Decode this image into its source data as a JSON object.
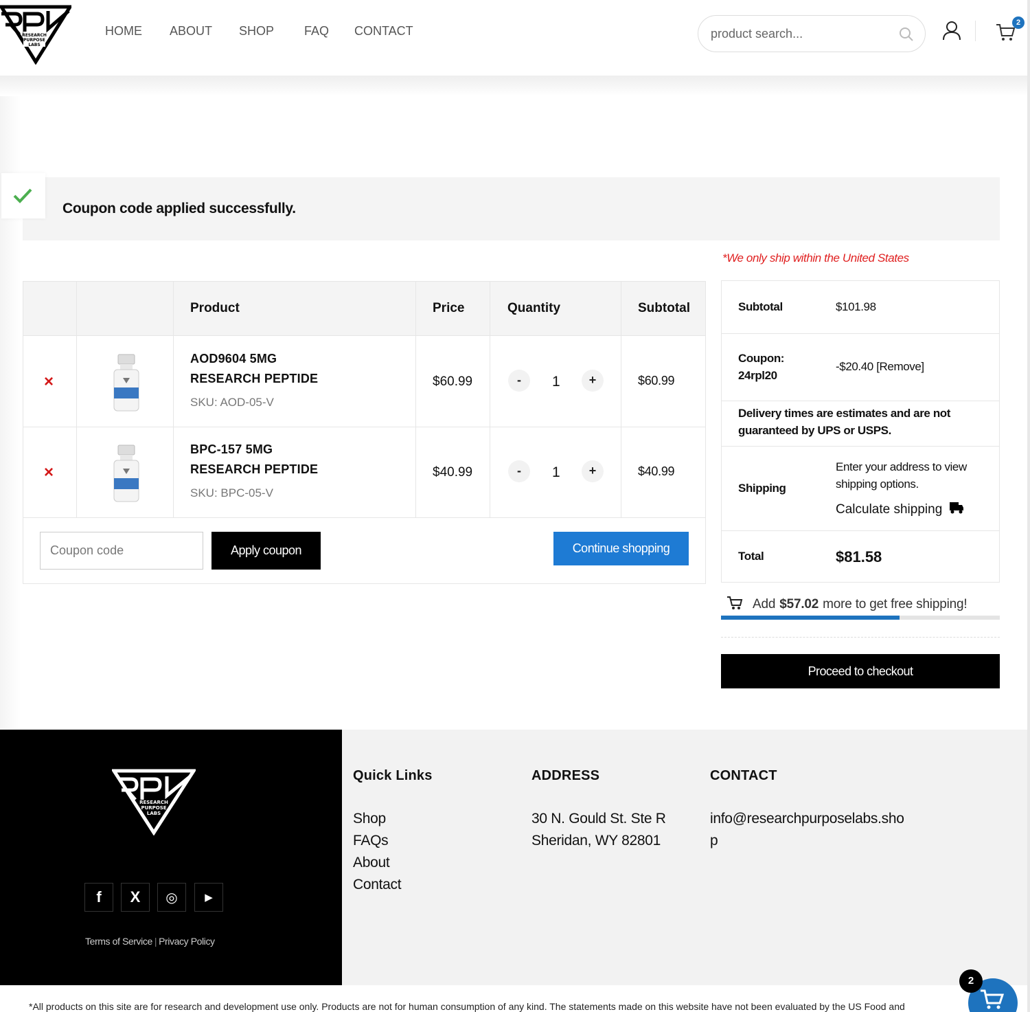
{
  "header": {
    "nav": [
      "HOME",
      "ABOUT",
      "SHOP",
      "FAQ",
      "CONTACT"
    ],
    "search_placeholder": "product search...",
    "cart_count": "2"
  },
  "notice": {
    "message": "Coupon code applied successfully."
  },
  "shipping_note": "*We only ship within the United States",
  "cart": {
    "columns": [
      "Product",
      "Price",
      "Quantity",
      "Subtotal"
    ],
    "items": [
      {
        "name_line1": "AOD9604 5MG",
        "name_line2": "RESEARCH PEPTIDE",
        "sku": "SKU: AOD-05-V",
        "price": "$60.99",
        "qty": "1",
        "subtotal": "$60.99"
      },
      {
        "name_line1": "BPC-157 5MG",
        "name_line2": "RESEARCH PEPTIDE",
        "sku": "SKU: BPC-05-V",
        "price": "$40.99",
        "qty": "1",
        "subtotal": "$40.99"
      }
    ],
    "remove_symbol": "×",
    "minus": "-",
    "plus": "+",
    "coupon_placeholder": "Coupon code",
    "apply_label": "Apply coupon",
    "continue_label": "Continue shopping"
  },
  "totals": {
    "subtotal_label": "Subtotal",
    "subtotal_value": "$101.98",
    "coupon_label_1": "Coupon:",
    "coupon_label_2": "24rpl20",
    "coupon_value": "-$20.40",
    "coupon_remove": "[Remove]",
    "delivery_note_1": "Delivery times are estimates and are not",
    "delivery_note_2": "guaranteed by UPS or USPS.",
    "shipping_label": "Shipping",
    "shipping_text_1": "Enter your address to view",
    "shipping_text_2": "shipping options.",
    "calc_shipping": "Calculate shipping",
    "total_label": "Total",
    "total_value": "$81.58"
  },
  "free_shipping": {
    "prefix": "Add",
    "amount": "$57.02",
    "suffix": "more to get free shipping!",
    "progress_fraction": 0.64
  },
  "checkout_label": "Proceed to checkout",
  "footer": {
    "quick_links_title": "Quick Links",
    "quick_links": [
      "Shop",
      "FAQs",
      "About",
      "Contact"
    ],
    "address_title": "ADDRESS",
    "address_line1": "30 N. Gould St. Ste R",
    "address_line2": "Sheridan, WY 82801",
    "contact_title": "CONTACT",
    "email_line1": "info@researchpurposelabs.sho",
    "email_line2": "p",
    "terms": "Terms of Service",
    "separator": "|",
    "privacy": "Privacy Policy",
    "socials": [
      "facebook-icon",
      "x-icon",
      "instagram-icon",
      "youtube-icon"
    ],
    "social_glyphs": [
      "f",
      "X",
      "◎",
      "▶"
    ]
  },
  "disclaimer": "*All products on this site are for research and development use only. Products are not for human consumption of any kind. The statements made on this website have not been evaluated by the US Food and",
  "floating_cart_count": "2",
  "colors": {
    "accent": "#1e73be",
    "button_blue": "#1e7bd4",
    "remove_red": "#d31818",
    "success_green": "#4caf50"
  }
}
